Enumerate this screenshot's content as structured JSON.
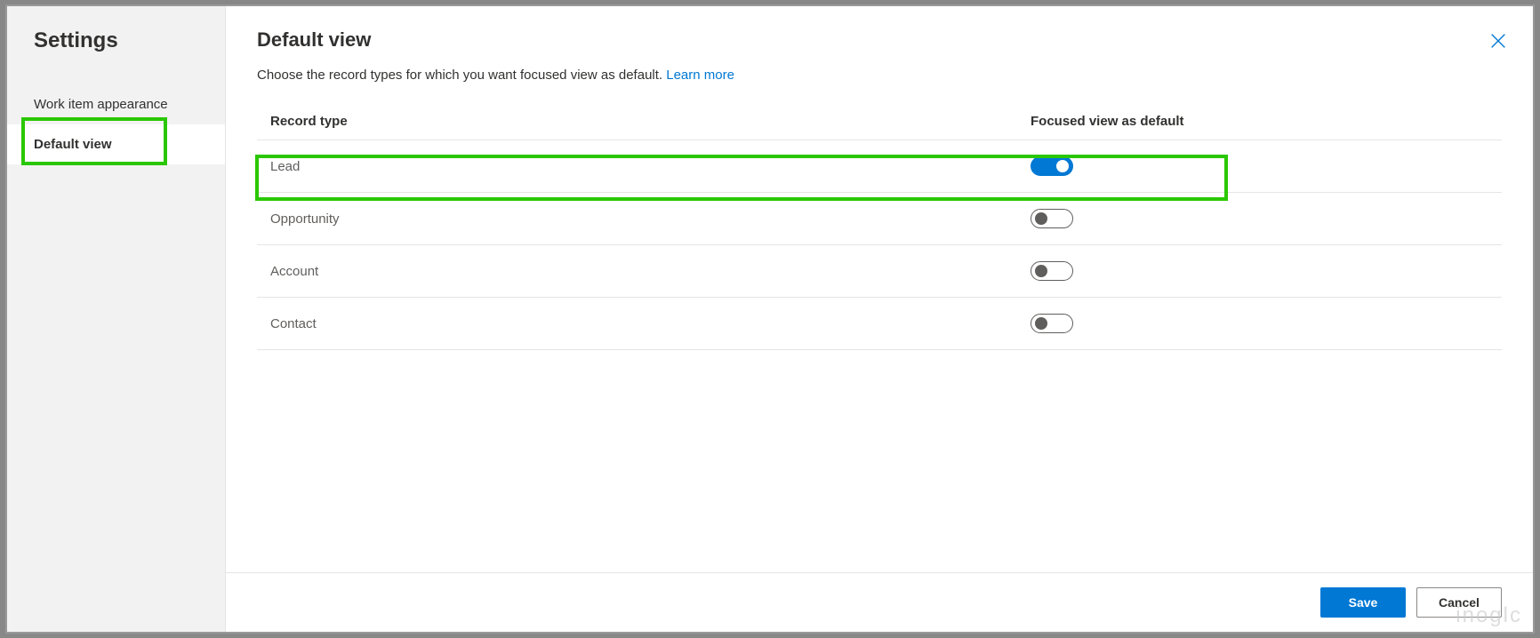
{
  "sidebar": {
    "title": "Settings",
    "items": [
      {
        "label": "Work item appearance",
        "active": false
      },
      {
        "label": "Default view",
        "active": true
      }
    ]
  },
  "main": {
    "title": "Default view",
    "subtitle_prefix": "Choose the record types for which you want focused view as default. ",
    "learn_more": "Learn more"
  },
  "table": {
    "header_record": "Record type",
    "header_toggle": "Focused view as default",
    "rows": [
      {
        "label": "Lead",
        "enabled": true
      },
      {
        "label": "Opportunity",
        "enabled": false
      },
      {
        "label": "Account",
        "enabled": false
      },
      {
        "label": "Contact",
        "enabled": false
      }
    ]
  },
  "footer": {
    "save": "Save",
    "cancel": "Cancel"
  },
  "watermark": "inoglc"
}
